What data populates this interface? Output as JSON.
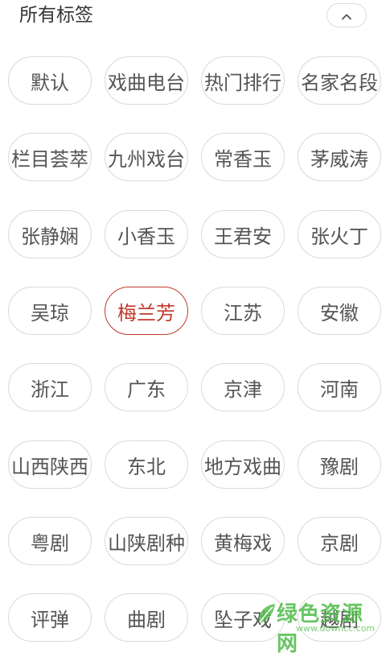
{
  "header": {
    "title": "所有标签",
    "collapse_icon": "chevron-up-icon"
  },
  "tags": [
    {
      "label": "默认",
      "selected": false
    },
    {
      "label": "戏曲电台",
      "selected": false
    },
    {
      "label": "热门排行",
      "selected": false
    },
    {
      "label": "名家名段",
      "selected": false
    },
    {
      "label": "栏目荟萃",
      "selected": false
    },
    {
      "label": "九州戏台",
      "selected": false
    },
    {
      "label": "常香玉",
      "selected": false
    },
    {
      "label": "茅威涛",
      "selected": false
    },
    {
      "label": "张静娴",
      "selected": false
    },
    {
      "label": "小香玉",
      "selected": false
    },
    {
      "label": "王君安",
      "selected": false
    },
    {
      "label": "张火丁",
      "selected": false
    },
    {
      "label": "吴琼",
      "selected": false
    },
    {
      "label": "梅兰芳",
      "selected": true
    },
    {
      "label": "江苏",
      "selected": false
    },
    {
      "label": "安徽",
      "selected": false
    },
    {
      "label": "浙江",
      "selected": false
    },
    {
      "label": "广东",
      "selected": false
    },
    {
      "label": "京津",
      "selected": false
    },
    {
      "label": "河南",
      "selected": false
    },
    {
      "label": "山西陕西",
      "selected": false
    },
    {
      "label": "东北",
      "selected": false
    },
    {
      "label": "地方戏曲",
      "selected": false
    },
    {
      "label": "豫剧",
      "selected": false
    },
    {
      "label": "粤剧",
      "selected": false
    },
    {
      "label": "山陕剧种",
      "selected": false
    },
    {
      "label": "黄梅戏",
      "selected": false
    },
    {
      "label": "京剧",
      "selected": false
    },
    {
      "label": "评弹",
      "selected": false
    },
    {
      "label": "曲剧",
      "selected": false
    },
    {
      "label": "坠子戏",
      "selected": false
    },
    {
      "label": "越剧",
      "selected": false
    }
  ],
  "watermark": {
    "text": "绿色资源网",
    "url": "www.downcc.com"
  },
  "colors": {
    "selected": "#c0392b",
    "border": "#d9d9d9",
    "text": "#555555"
  }
}
